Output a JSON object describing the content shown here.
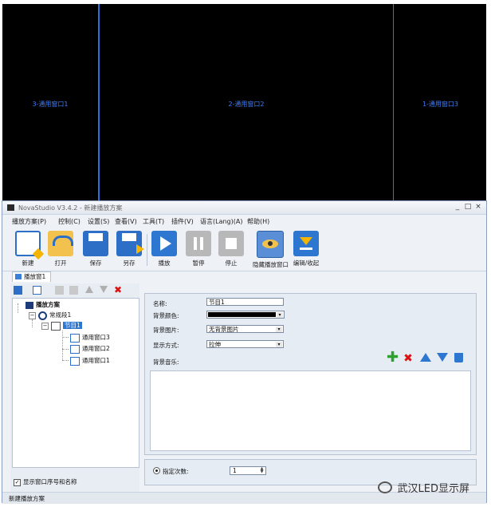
{
  "preview": {
    "windows": [
      {
        "label": "3-通用窗口1"
      },
      {
        "label": "2-通用窗口2"
      },
      {
        "label": "1-通用窗口3"
      }
    ]
  },
  "window": {
    "title": "NovaStudio V3.4.2 - 新建播放方案",
    "controls": {
      "minimize": "_",
      "maximize": "□",
      "close": "×"
    }
  },
  "menu": [
    "播放方案(P)",
    "控制(C)",
    "设置(S)",
    "查看(V)",
    "工具(T)",
    "插件(V)",
    "语言(Lang)(A)",
    "帮助(H)"
  ],
  "toolbar": {
    "new": "新建",
    "open": "打开",
    "save": "保存",
    "save_as": "另存",
    "play": "播放",
    "pause": "暂停",
    "stop": "停止",
    "hide_window": "隐藏播放窗口",
    "edit_collapse": "编辑/收起"
  },
  "tab": {
    "label": "播放窗1"
  },
  "tree": {
    "root": "播放方案",
    "segment": "常规段1",
    "program": "节目1",
    "windows": [
      "通用窗口3",
      "通用窗口2",
      "通用窗口1"
    ]
  },
  "left": {
    "show_names": "显示窗口序号和名称",
    "checked": "✓"
  },
  "props": {
    "name_label": "名称:",
    "name_value": "节目1",
    "bgcolor_label": "背景颜色:",
    "bgcolor_value": "#000000",
    "bgimage_label": "背景图片:",
    "bgimage_value": "无背景图片",
    "display_label": "显示方式:",
    "display_value": "拉伸",
    "music_label": "背景音乐:"
  },
  "playcount": {
    "label": "指定次数:",
    "value": "1"
  },
  "status": {
    "text": "新建播放方案"
  },
  "watermark": {
    "text": "武汉LED显示屏"
  }
}
